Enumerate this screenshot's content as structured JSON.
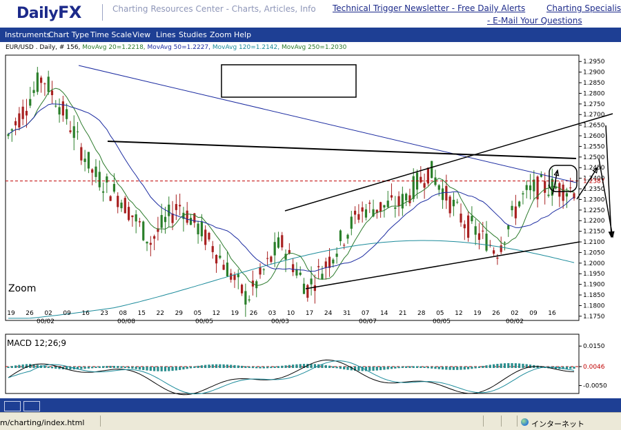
{
  "header": {
    "logo_prefix": "Daily",
    "logo_suffix": "FX",
    "site_link": "Charting Resources Center - Charts, Articles, Info",
    "links": [
      "Technical Trigger Newsletter - Free Daily Alerts",
      "Charting Specialist",
      "- E-Mail Your Questions"
    ]
  },
  "menu": [
    "Instruments",
    "Chart Type",
    "Time Scale",
    "View",
    "Lines",
    "Studies",
    "Zoom",
    "Help"
  ],
  "chart_info": {
    "symbol": "EUR/USD . Daily, # 156,",
    "ma20": "MovAvg 20=1.2218,",
    "ma50": "MovAvg 50=1.2227,",
    "ma120": "MovAvg 120=1.2142,",
    "ma250": "MovAvg 250=1.2030"
  },
  "zoom_label": "Zoom",
  "macd_label": "MACD 12;26;9",
  "status": {
    "url": "m/charting/index.html",
    "zone": "インターネット"
  },
  "colors": {
    "menubar": "#1e3f94",
    "ma20": "#2b7a2b",
    "ma50": "#1a2aa0",
    "ma120": "#1a8a9a",
    "last_price": "#c00000",
    "up_candle": "#2a7f2a",
    "down_candle": "#a82020",
    "macd_hist": "#2a8e8e"
  },
  "chart_data": [
    {
      "type": "candlestick",
      "title": "EUR/USD . Daily, # 156",
      "y_ticks": [
        "1.2950",
        "1.2900",
        "1.2850",
        "1.2800",
        "1.2750",
        "1.2700",
        "1.2650",
        "1.2600",
        "1.2550",
        "1.2500",
        "1.2450",
        "1.2400",
        "1.2350",
        "1.2300",
        "1.2250",
        "1.2200",
        "1.2150",
        "1.2100",
        "1.2050",
        "1.2000",
        "1.1950",
        "1.1900",
        "1.1850",
        "1.1800",
        "1.1750"
      ],
      "ylim": [
        1.173,
        1.298
      ],
      "last_price_label": "1.2387",
      "last_price": 1.2387,
      "x_day_labels": [
        "19",
        "26",
        "02",
        "09",
        "16",
        "23",
        "08",
        "15",
        "22",
        "29",
        "05",
        "12",
        "19",
        "26",
        "03",
        "10",
        "17",
        "24",
        "31",
        "07",
        "14",
        "21",
        "28",
        "05",
        "12",
        "19",
        "26",
        "02",
        "09",
        "16"
      ],
      "x_month_labels": [
        "00/02",
        "00/08",
        "00/05",
        "00/03",
        "00/07",
        "00/05",
        "00/02"
      ],
      "moving_averages": [
        {
          "name": "MovAvg 20",
          "last": 1.2218
        },
        {
          "name": "MovAvg 50",
          "last": 1.2227
        },
        {
          "name": "MovAvg 120",
          "last": 1.2142
        },
        {
          "name": "MovAvg 250",
          "last": 1.203
        }
      ]
    },
    {
      "type": "line",
      "title": "MACD 12;26;9",
      "y_ticks": [
        "0.0150",
        "0.0046",
        "-0.0050"
      ],
      "ylim": [
        -0.009,
        0.021
      ],
      "last_value_label": "0.0046",
      "last_value": 0.0046
    }
  ]
}
